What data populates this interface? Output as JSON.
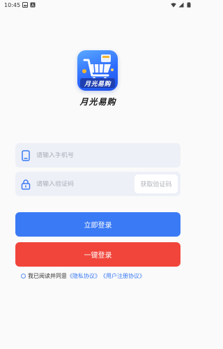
{
  "status_bar": {
    "time": "10:45"
  },
  "app": {
    "name": "月光易购",
    "logo_text": "月光易购"
  },
  "form": {
    "phone_placeholder": "请输入手机号",
    "code_placeholder": "请输入验证码",
    "get_code_label": "获取验证码"
  },
  "buttons": {
    "login_label": "立即登录",
    "oneclick_label": "一键登录"
  },
  "agreement": {
    "prefix": "我已阅读并同意",
    "privacy_label": "《隐私协议》",
    "terms_label": "《用户注册协议》"
  },
  "colors": {
    "primary": "#3a7af5",
    "danger": "#f1453b",
    "field_bg": "#eef0f7"
  }
}
